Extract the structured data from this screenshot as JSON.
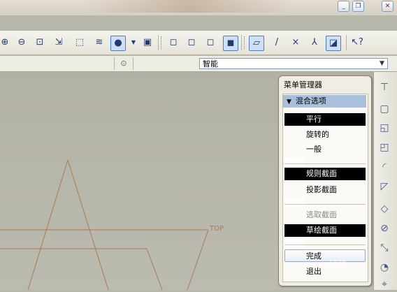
{
  "menu_manager": {
    "title": "菜单管理器",
    "section": "混合选项",
    "items": [
      {
        "label": "平行",
        "selected": true
      },
      {
        "label": "旋转的",
        "selected": false
      },
      {
        "label": "一般",
        "selected": false
      },
      {
        "label": "规则截面",
        "selected": true
      },
      {
        "label": "投影截面",
        "selected": false
      },
      {
        "label": "选取截面",
        "selected": false,
        "disabled": true
      },
      {
        "label": "草绘截面",
        "selected": true
      },
      {
        "label": "完成",
        "selected": false
      },
      {
        "label": "退出",
        "selected": false
      }
    ]
  },
  "filter": {
    "value": "智能"
  },
  "canvas": {
    "datum_label": "TOP",
    "line_color": "#b0784a"
  },
  "watermark": "经验",
  "colors": {
    "selection": "#000000",
    "menu_header": "#a8c0dc",
    "canvas": "#b8b7ab"
  }
}
